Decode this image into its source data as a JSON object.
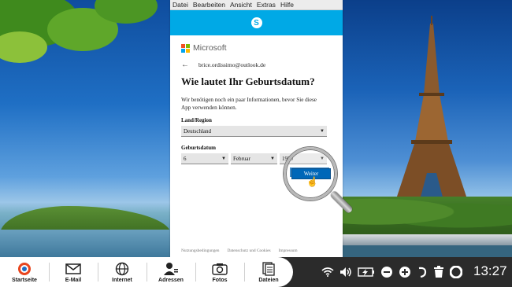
{
  "menubar": {
    "items": [
      "Datei",
      "Bearbeiten",
      "Ansicht",
      "Extras",
      "Hilfe"
    ]
  },
  "signin": {
    "brand": "Microsoft",
    "account_email": "brice.ordissimo@outlook.de",
    "heading": "Wie lautet Ihr Geburtsdatum?",
    "description": "Wir benötigen noch ein paar Informationen, bevor Sie diese App verwenden können.",
    "country_label": "Land/Region",
    "country_value": "Deutschland",
    "birthdate_label": "Geburtsdatum",
    "day_value": "6",
    "month_value": "Februar",
    "year_value": "1970",
    "next_label": "Weiter",
    "footer": [
      "Nutzungsbedingungen",
      "Datenschutz und Cookies",
      "Impressum"
    ]
  },
  "dock": {
    "items": [
      {
        "label": "Startseite",
        "icon": "home-icon"
      },
      {
        "label": "E-Mail",
        "icon": "mail-icon"
      },
      {
        "label": "Internet",
        "icon": "globe-icon"
      },
      {
        "label": "Adressen",
        "icon": "contacts-icon"
      },
      {
        "label": "Fotos",
        "icon": "camera-icon"
      },
      {
        "label": "Dateien",
        "icon": "files-icon"
      }
    ]
  },
  "tray": {
    "icons": [
      "wifi-icon",
      "volume-icon",
      "battery-icon",
      "zoom-out-icon",
      "zoom-in-icon",
      "help-icon",
      "trash-icon",
      "lifebuoy-icon"
    ],
    "time": "13:27"
  },
  "colors": {
    "skype_blue": "#00a9e6",
    "ms_button": "#0067b8",
    "taskbar": "#2b2b2b"
  }
}
